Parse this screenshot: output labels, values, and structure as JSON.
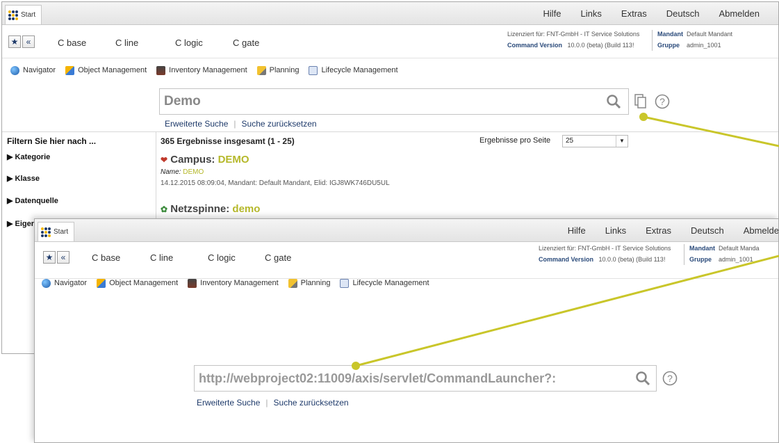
{
  "tab": {
    "label": "Start"
  },
  "top_menu": [
    "Hilfe",
    "Links",
    "Extras",
    "Deutsch",
    "Abmelden"
  ],
  "top_menu_bottom": [
    "Hilfe",
    "Links",
    "Extras",
    "Deutsch",
    "Abmelde"
  ],
  "c_menu": [
    "C base",
    "C line",
    "C logic",
    "C gate"
  ],
  "license": {
    "label": "Lizenziert für: FNT-GmbH - IT Service Solutions",
    "cmd_label": "Command Version",
    "cmd_value": "10.0.0 (beta) (Build 113!",
    "mandant_label": "Mandant",
    "mandant_value": "Default Mandant",
    "mandant_value_bottom": "Default Manda",
    "gruppe_label": "Gruppe",
    "gruppe_value": "admin_1001"
  },
  "modules": [
    "Navigator",
    "Object Management",
    "Inventory Management",
    "Planning",
    "Lifecycle Management"
  ],
  "search_top": {
    "value": "Demo"
  },
  "search_bottom": {
    "value": "http://webproject02:11009/axis/servlet/CommandLauncher?:"
  },
  "search_links": {
    "advanced": "Erweiterte Suche",
    "reset": "Suche zurücksetzen"
  },
  "filter": {
    "heading": "Filtern Sie hier nach ...",
    "items": [
      "Kategorie",
      "Klasse",
      "Datenquelle",
      "Eiger"
    ]
  },
  "results": {
    "summary": "365 Ergebnisse insgesamt (1 - 25)",
    "per_page_label": "Ergebnisse pro Seite",
    "per_page_value": "25",
    "item1_type": "Campus: ",
    "item1_name": "DEMO",
    "item1_name_label": "Name: ",
    "item1_name_value": "DEMO",
    "item1_meta": "14.12.2015 08:09:04, Mandant: Default Mandant, Elid: IGJ8WK746DU5UL",
    "item2_type": "Netzspinne: ",
    "item2_name": "demo"
  },
  "colors": {
    "accent": "#b5b82a",
    "link": "#1e3a6a",
    "callout": "#c9c62a"
  }
}
